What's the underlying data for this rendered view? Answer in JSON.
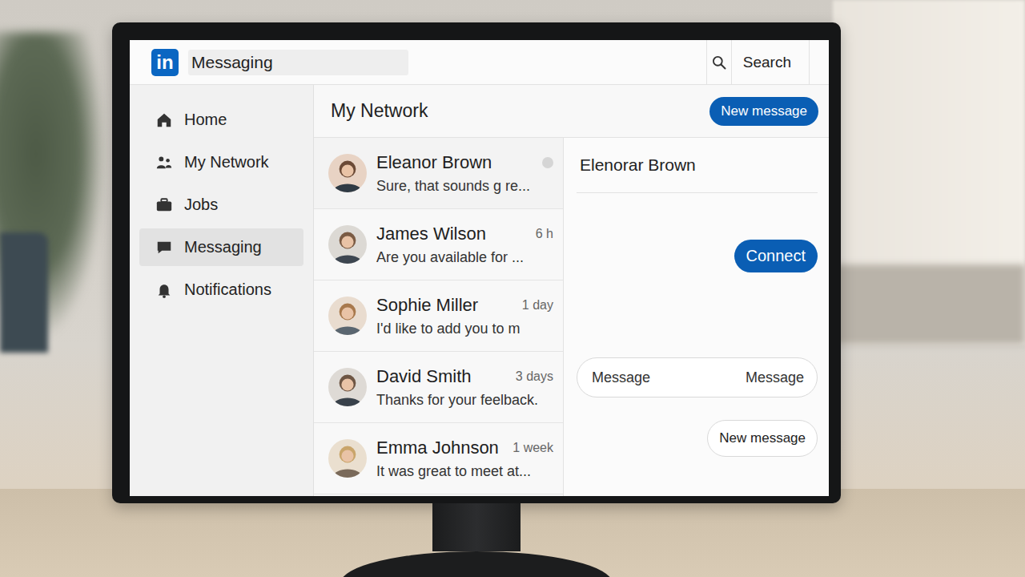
{
  "app": {
    "logo": "in",
    "title": "Messaging"
  },
  "search": {
    "button": "Search"
  },
  "sidebar": {
    "items": [
      {
        "label": "Home",
        "selected": false
      },
      {
        "label": "My Network",
        "selected": false
      },
      {
        "label": "Jobs",
        "selected": false
      },
      {
        "label": "Messaging",
        "selected": true
      },
      {
        "label": "Notifications",
        "selected": false
      }
    ]
  },
  "list": {
    "title": "My Network",
    "new_message": "New message",
    "conversations": [
      {
        "name": "Eleanor Brown",
        "preview": "Sure, that sounds g re...",
        "unread": true
      },
      {
        "name": "James Wilson",
        "time": "6 h",
        "preview": "Are you available for ...",
        "unread": false
      },
      {
        "name": "Sophie Miller",
        "time": "1 day",
        "preview": "I'd like to add you to m",
        "unread": false
      },
      {
        "name": "David Smith",
        "time": "3 days",
        "preview": "Thanks for your feelback.",
        "unread": false
      },
      {
        "name": "Emma Johnson",
        "time": "1 week",
        "preview": "It was great to meet at...",
        "unread": false
      }
    ]
  },
  "conversation": {
    "name": "Elenorar Brown",
    "connect": "Connect",
    "message_placeholder": "Message",
    "send": "Message",
    "new_message": "New message"
  }
}
